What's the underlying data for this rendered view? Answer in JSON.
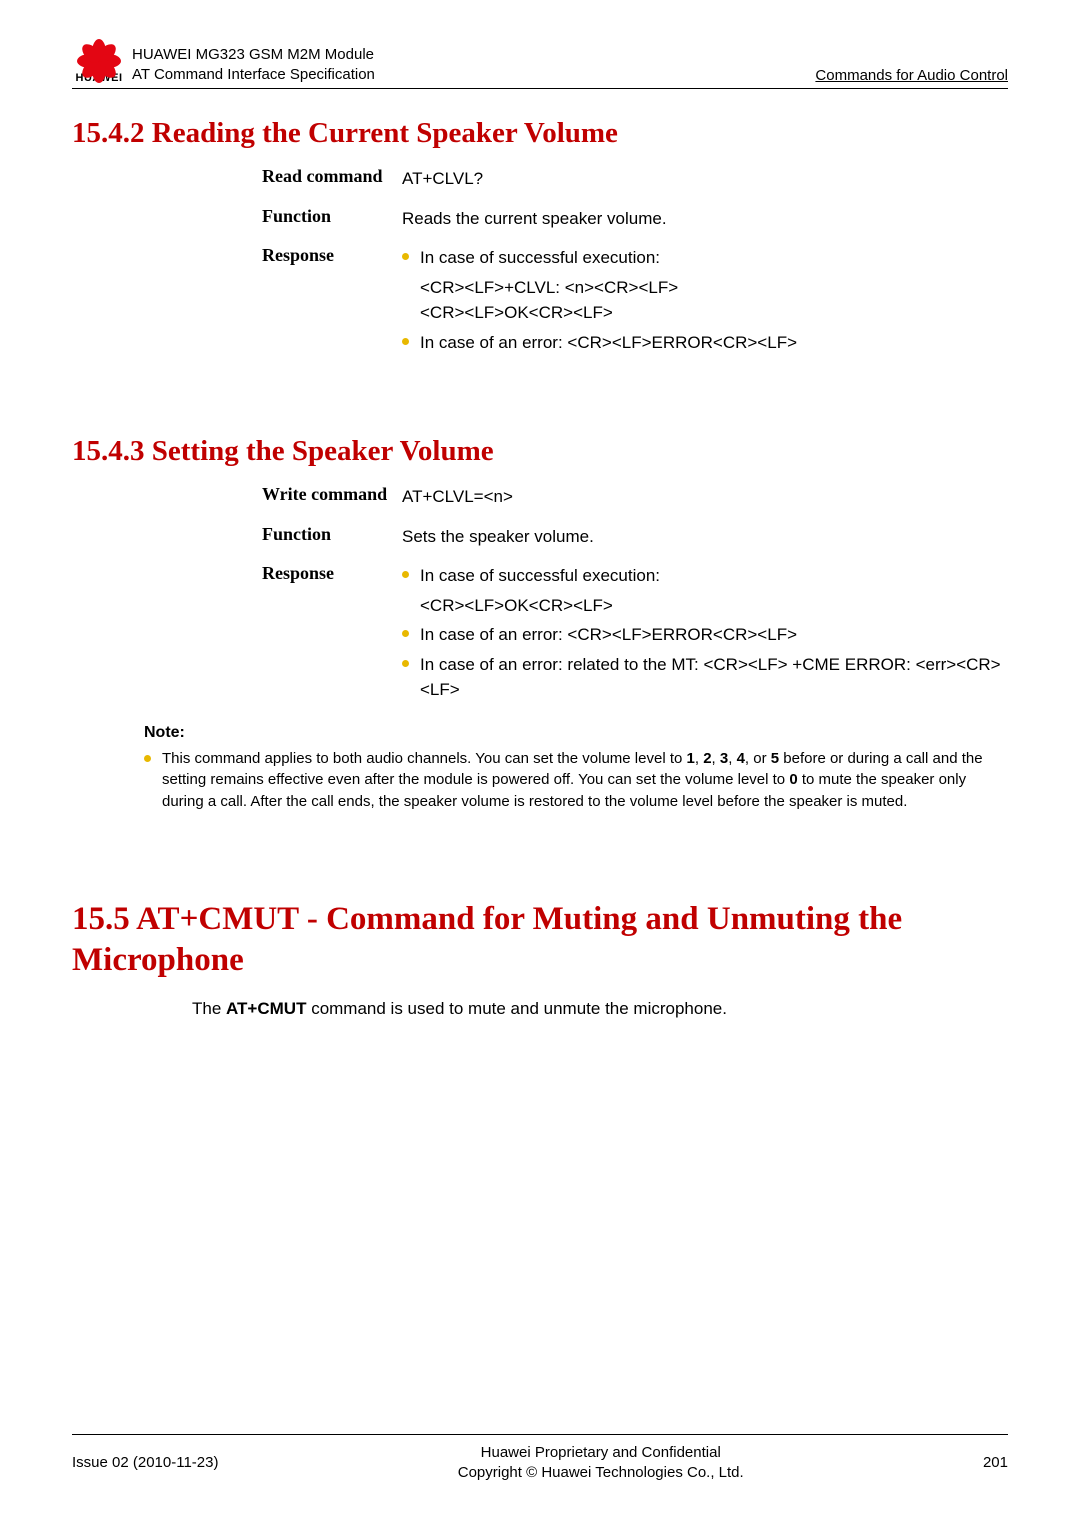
{
  "header": {
    "product_line": "HUAWEI MG323 GSM M2M Module",
    "doc_line": "AT Command Interface Specification",
    "brand": "HUAWEI",
    "right": "Commands for Audio Control"
  },
  "sec1": {
    "heading": "15.4.2 Reading the Current Speaker Volume",
    "rows": {
      "read_label": "Read command",
      "read_val": "AT+CLVL?",
      "func_label": "Function",
      "func_val": "Reads the current speaker volume.",
      "resp_label": "Response",
      "resp_items": [
        "In case of successful execution:",
        "<CR><LF>+CLVL: <n><CR><LF>",
        "<CR><LF>OK<CR><LF>",
        "In case of an error: <CR><LF>ERROR<CR><LF>"
      ]
    }
  },
  "sec2": {
    "heading": "15.4.3 Setting the Speaker Volume",
    "rows": {
      "write_label": "Write command",
      "write_val": "AT+CLVL=<n>",
      "func_label": "Function",
      "func_val": "Sets the speaker volume.",
      "resp_label": "Response",
      "resp_items": [
        "In case of successful execution:",
        "<CR><LF>OK<CR><LF>",
        "In case of an error: <CR><LF>ERROR<CR><LF>",
        "In case of an error: related to the MT: <CR><LF> +CME ERROR: <err><CR><LF>"
      ]
    },
    "note_title": "Note:",
    "note_body": "This command applies to both audio channels. You can set the volume level to 1, 2, 3, 4, or 5 before or during a call and the setting remains effective even after the module is powered off. You can set the volume level to 0 to mute the speaker only during a call. After the call ends, the speaker volume is restored to the volume level before the speaker is muted."
  },
  "sec3": {
    "heading": "15.5 AT+CMUT - Command for Muting and Unmuting the Microphone",
    "para": "The AT+CMUT command is used to mute and unmute the microphone."
  },
  "footer": {
    "left": "Issue 02 (2010-11-23)",
    "center1": "Huawei Proprietary and Confidential",
    "center2": "Copyright © Huawei Technologies Co., Ltd.",
    "right": "201"
  }
}
